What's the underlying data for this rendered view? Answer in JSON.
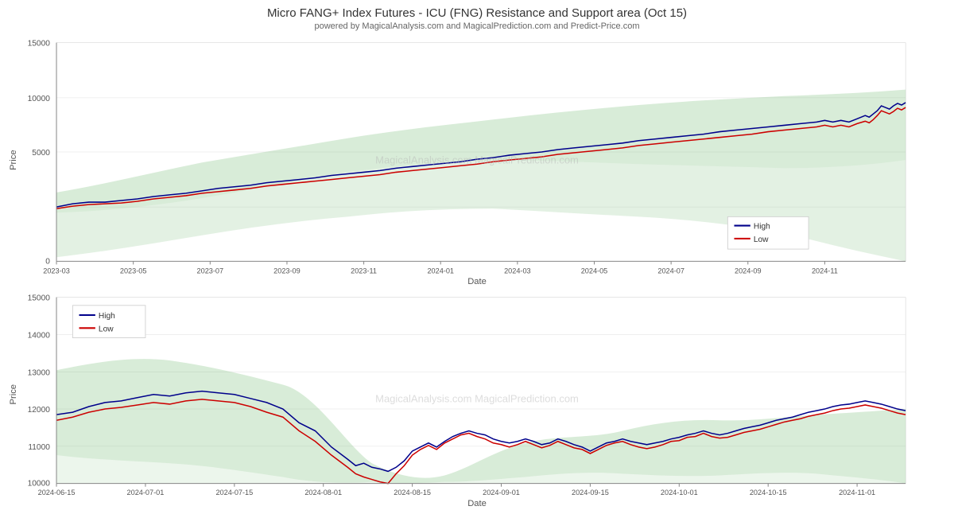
{
  "header": {
    "title": "Micro FANG+ Index Futures - ICU (FNG) Resistance and Support area (Oct 15)",
    "subtitle": "powered by MagicalAnalysis.com and MagicalPrediction.com and Predict-Price.com"
  },
  "chart1": {
    "y_axis_label": "Price",
    "x_axis_label": "Date",
    "x_ticks": [
      "2023-03",
      "2023-05",
      "2023-07",
      "2023-09",
      "2023-11",
      "2024-01",
      "2024-03",
      "2024-05",
      "2024-07",
      "2024-09",
      "2024-11"
    ],
    "y_ticks": [
      "0",
      "5000",
      "10000",
      "15000"
    ],
    "legend": [
      {
        "label": "High",
        "color": "#00008B"
      },
      {
        "label": "Low",
        "color": "#CC0000"
      }
    ]
  },
  "chart2": {
    "y_axis_label": "Price",
    "x_axis_label": "Date",
    "x_ticks": [
      "2024-06-15",
      "2024-07-01",
      "2024-07-15",
      "2024-08-01",
      "2024-08-15",
      "2024-09-01",
      "2024-09-15",
      "2024-10-01",
      "2024-10-15",
      "2024-11-01"
    ],
    "y_ticks": [
      "10000",
      "11000",
      "12000",
      "13000",
      "14000",
      "15000"
    ],
    "legend": [
      {
        "label": "High",
        "color": "#00008B"
      },
      {
        "label": "Low",
        "color": "#CC0000"
      }
    ]
  },
  "watermark1": "MagicalAnalysis.com          MagicalPrediction.com",
  "watermark2": "MagicalAnalysis.com          MagicalPrediction.com"
}
